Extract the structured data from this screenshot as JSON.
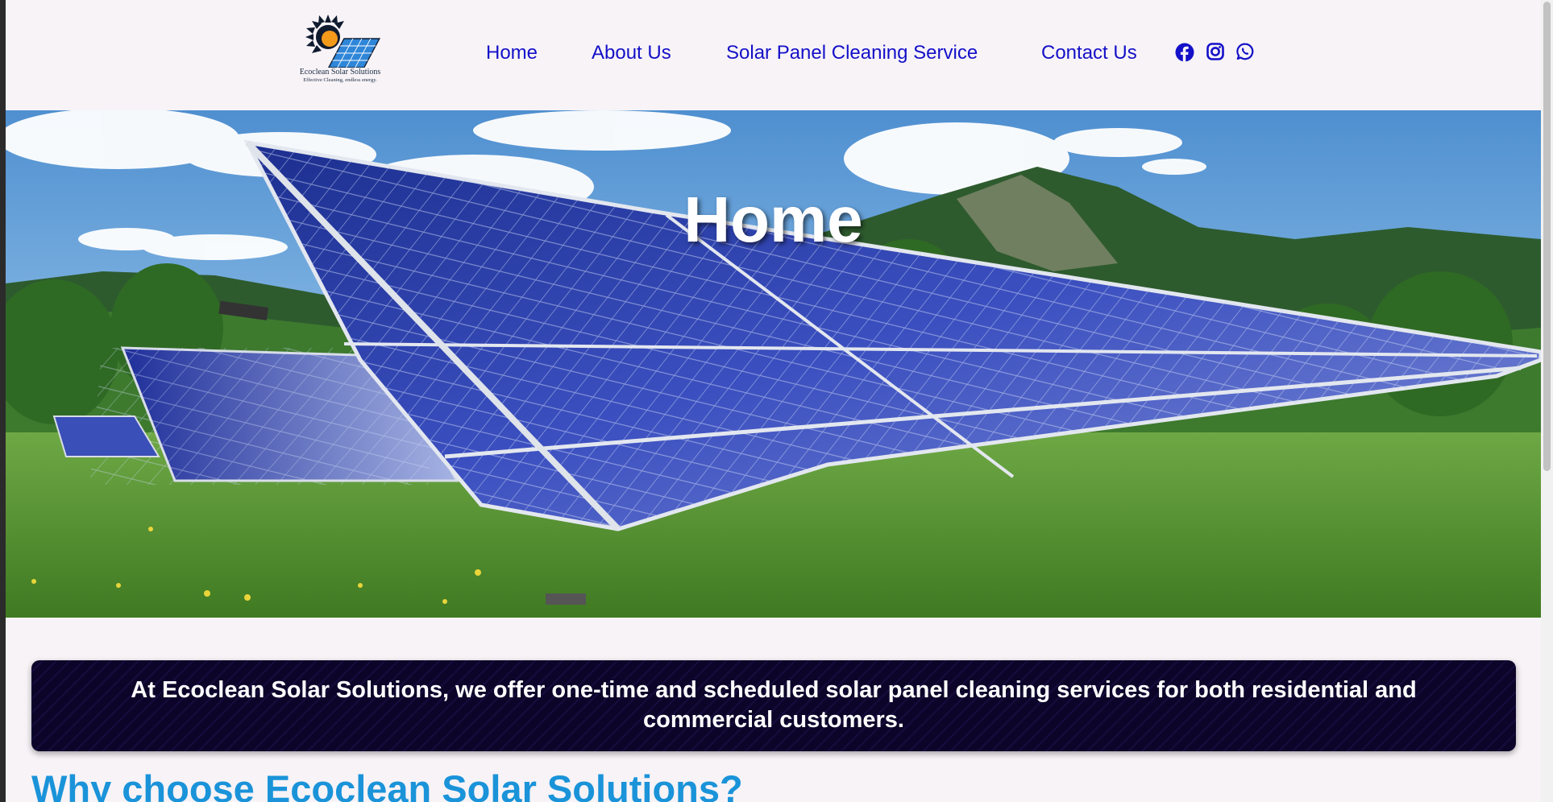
{
  "brand": {
    "name": "Ecoclean Solar Solutions",
    "tagline": "Effective Cleaning, endless energy.",
    "logo_icon": "sun-solar-panel-logo"
  },
  "nav": {
    "items": [
      {
        "label": "Home"
      },
      {
        "label": "About Us"
      },
      {
        "label": "Solar Panel Cleaning Service"
      },
      {
        "label": "Contact Us"
      }
    ],
    "link_color": "#1410c8"
  },
  "social": {
    "icons": [
      "facebook-icon",
      "instagram-icon",
      "whatsapp-icon"
    ]
  },
  "hero": {
    "title": "Home",
    "image": "solar-panels-field-mountains"
  },
  "banner": {
    "text": "At Ecoclean Solar Solutions, we offer one-time and scheduled solar panel cleaning services for both residential and commercial customers.",
    "background": "#0c0529"
  },
  "section": {
    "title": "Why choose Ecoclean Solar Solutions?",
    "title_color": "#1a93d9"
  }
}
